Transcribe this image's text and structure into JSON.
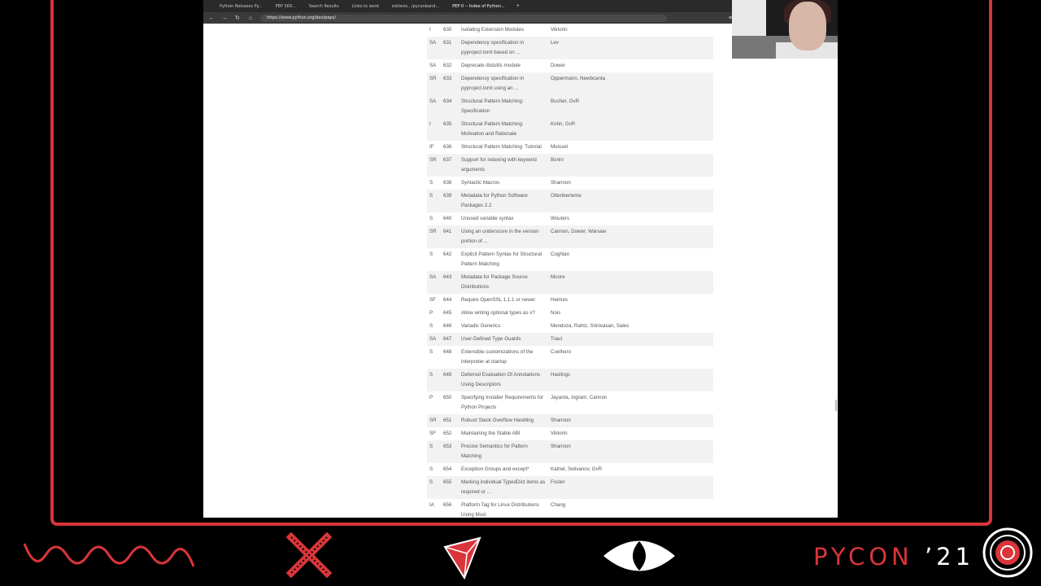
{
  "browser": {
    "tabs": [
      {
        "label": "Python Releases Py..."
      },
      {
        "label": "PEP 569..."
      },
      {
        "label": "Search Results"
      },
      {
        "label": "Links to send"
      },
      {
        "label": "zsklevis.../pyconband..."
      },
      {
        "label": "PEP 0 -- Index of Python..."
      }
    ],
    "active_tab": 5,
    "new_tab_label": "+",
    "nav_back": "←",
    "nav_forward": "→",
    "nav_reload": "↻",
    "nav_home": "⌂",
    "url": "https://www.python.org/dev/peps/",
    "menu": "≡"
  },
  "pep_rows": [
    {
      "type": "I",
      "num": "630",
      "title": "Isolating Extension Modules",
      "authors": "Viktorin"
    },
    {
      "type": "SA",
      "num": "631",
      "title": "Dependency specification in pyproject.toml based on ...",
      "authors": "Lev"
    },
    {
      "type": "SA",
      "num": "632",
      "title": "Deprecate distutils module",
      "authors": "Dower"
    },
    {
      "type": "SR",
      "num": "633",
      "title": "Dependency specification in pyproject.toml using an ...",
      "authors": "Oppermann, Newbcanta"
    },
    {
      "type": "SA",
      "num": "634",
      "title": "Structural Pattern Matching: Specification",
      "authors": "Bucher, GvR"
    },
    {
      "type": "I",
      "num": "635",
      "title": "Structural Pattern Matching: Motivation and Rationale",
      "authors": "Kohn, GvR"
    },
    {
      "type": "IF",
      "num": "636",
      "title": "Structural Pattern Matching: Tutorial",
      "authors": "Moisset"
    },
    {
      "type": "SR",
      "num": "637",
      "title": "Support for indexing with keyword arguments",
      "authors": "Borini"
    },
    {
      "type": "S",
      "num": "638",
      "title": "Syntactic Macros",
      "authors": "Shannon"
    },
    {
      "type": "S",
      "num": "639",
      "title": "Metadata for Python Software Packages 2.2",
      "authors": "Ottenberteme"
    },
    {
      "type": "S",
      "num": "640",
      "title": "Unused variable syntax",
      "authors": "Wouters"
    },
    {
      "type": "SR",
      "num": "641",
      "title": "Using an underscore in the version portion of ...",
      "authors": "Cannon, Dower, Warsaw"
    },
    {
      "type": "S",
      "num": "642",
      "title": "Explicit Pattern Syntax for Structural Pattern Matching",
      "authors": "Coghlan"
    },
    {
      "type": "SA",
      "num": "643",
      "title": "Metadata for Package Source Distributions",
      "authors": "Moore"
    },
    {
      "type": "SF",
      "num": "644",
      "title": "Require OpenSSL 1.1.1 or newer",
      "authors": "Heimes"
    },
    {
      "type": "P",
      "num": "645",
      "title": "Allow writing optional types as x?",
      "authors": "Nois"
    },
    {
      "type": "S",
      "num": "646",
      "title": "Variadic Generics",
      "authors": "Mendoza, Rahtz, Srinivasan, Sales"
    },
    {
      "type": "SA",
      "num": "647",
      "title": "User-Defined Type Guards",
      "authors": "Traut"
    },
    {
      "type": "S",
      "num": "648",
      "title": "Extensible customizations of the interpreter at startup",
      "authors": "Coelhero"
    },
    {
      "type": "S",
      "num": "649",
      "title": "Deferred Evaluation Of Annotations Using Descriptors",
      "authors": "Hastings"
    },
    {
      "type": "P",
      "num": "650",
      "title": "Specifying Installer Requirements for Python Projects",
      "authors": "Jayanta, Ingram, Cannon"
    },
    {
      "type": "SR",
      "num": "651",
      "title": "Robust Stack Overflow Handling",
      "authors": "Shannon"
    },
    {
      "type": "SF",
      "num": "652",
      "title": "Maintaining the Stable ABI",
      "authors": "Viktorin"
    },
    {
      "type": "S",
      "num": "653",
      "title": "Precise Semantics for Pattern Matching",
      "authors": "Shannon"
    },
    {
      "type": "S",
      "num": "654",
      "title": "Exception Groups and except*",
      "authors": "Katriel, Selivanov, GvR"
    },
    {
      "type": "S",
      "num": "655",
      "title": "Marking individual TypedDict items as required or ...",
      "authors": "Foster"
    },
    {
      "type": "IA",
      "num": "656",
      "title": "Platform Tag for Linux Distributions Using Musl",
      "authors": "Chang"
    }
  ],
  "footer": {
    "brand": "PYCON",
    "year": "’21"
  },
  "colors": {
    "accent": "#d9353a",
    "background": "#000000",
    "row_shade": "#f2f2f2"
  }
}
